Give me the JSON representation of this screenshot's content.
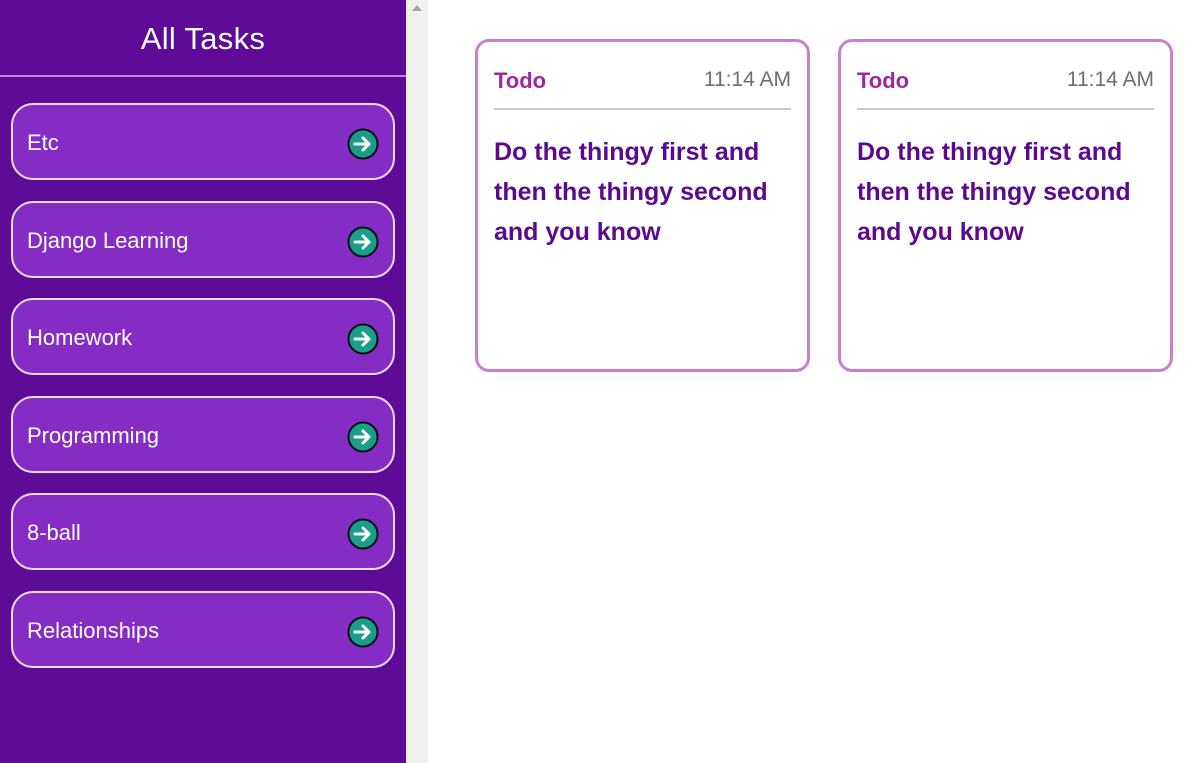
{
  "sidebar": {
    "title": "All Tasks",
    "items": [
      {
        "label": "Etc"
      },
      {
        "label": "Django Learning"
      },
      {
        "label": "Homework"
      },
      {
        "label": "Programming"
      },
      {
        "label": "8-ball"
      },
      {
        "label": "Relationships"
      }
    ]
  },
  "cards": [
    {
      "status": "Todo",
      "time": "11:14 AM",
      "text": "Do the thingy first and then the thingy second and you know"
    },
    {
      "status": "Todo",
      "time": "11:14 AM",
      "text": "Do the thingy first and then the thingy second and you know"
    }
  ],
  "colors": {
    "sidebar_bg": "#5e0b98",
    "item_bg": "#842cc4",
    "arrow_circle": "#1a9e8a",
    "card_border": "#cc7fd0",
    "status_text": "#a0279e",
    "body_text": "#5b0a8e"
  },
  "icons": {
    "item_action": "arrow-right-circle-icon",
    "scroll": "scroll-up-arrow-icon"
  }
}
